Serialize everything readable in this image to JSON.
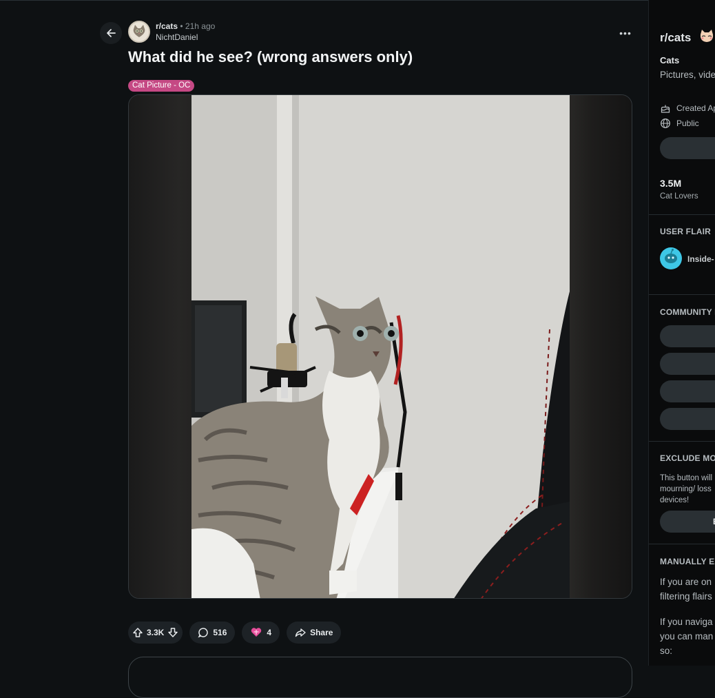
{
  "post": {
    "subreddit": "r/cats",
    "separator": "•",
    "time": "21h ago",
    "author": "NichtDaniel",
    "more_label": "•••",
    "title": "What did he see? (wrong answers only)",
    "flair": "Cat Picture - OC",
    "upvotes": "3.3K",
    "comments": "516",
    "awards": "4",
    "share_label": "Share"
  },
  "sidebar": {
    "title": "r/cats",
    "name": "Cats",
    "description": "Pictures, vide featuring/abo",
    "created": "Created Ap",
    "visibility": "Public",
    "members_count": "3.5M",
    "members_label": "Cat Lovers",
    "user_flair_heading": "USER FLAIR",
    "user_flair_name": "Inside-",
    "community_heading": "COMMUNITY B",
    "exclude_heading": "EXCLUDE MOU",
    "exclude_text": "This button will mourning/ loss devices!",
    "exclude_button": "E",
    "manual_heading": "MANUALLY EX",
    "manual_text_1": "If you are on filtering flairs",
    "manual_text_2": "If you naviga you can man so:"
  },
  "colors": {
    "background": "#0e1113",
    "flair": "#c54984",
    "pill": "#1d2226",
    "award": "#e64d9a"
  },
  "icons": [
    "back-arrow-icon",
    "more-icon",
    "upvote-icon",
    "downvote-icon",
    "comment-icon",
    "award-icon",
    "share-icon",
    "cake-icon",
    "globe-icon"
  ]
}
